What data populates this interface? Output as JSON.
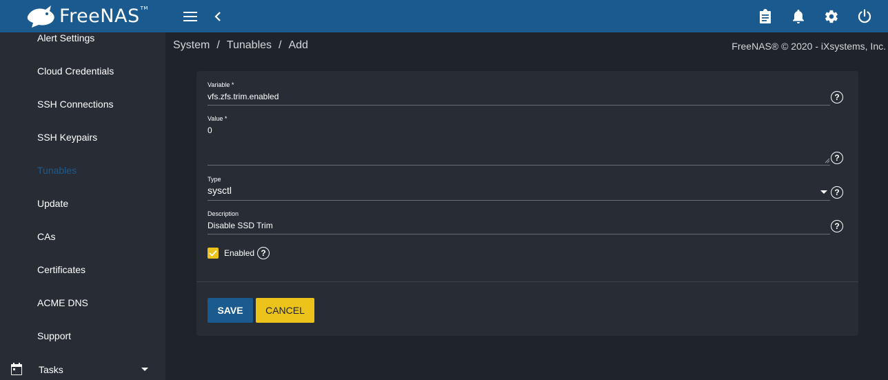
{
  "app": {
    "logo_text": "FreeNAS",
    "logo_tm": "TM"
  },
  "topbar": {
    "menu_icon": "hamburger-menu-icon",
    "back_icon": "chevron-left-icon",
    "right_icons": [
      "clipboard-icon",
      "bell-icon",
      "gear-icon",
      "power-icon"
    ]
  },
  "sidebar": {
    "items": [
      {
        "label": "Alert Settings"
      },
      {
        "label": "Cloud Credentials"
      },
      {
        "label": "SSH Connections"
      },
      {
        "label": "SSH Keypairs"
      },
      {
        "label": "Tunables",
        "active": true
      },
      {
        "label": "Update"
      },
      {
        "label": "CAs"
      },
      {
        "label": "Certificates"
      },
      {
        "label": "ACME DNS"
      },
      {
        "label": "Support"
      }
    ],
    "tasks": {
      "label": "Tasks",
      "icon": "calendar-icon"
    }
  },
  "breadcrumb": {
    "items": [
      "System",
      "Tunables",
      "Add"
    ],
    "separator": "/"
  },
  "copyright": "FreeNAS® © 2020 - iXsystems, Inc.",
  "form": {
    "variable": {
      "label": "Variable *",
      "value": "vfs.zfs.trim.enabled"
    },
    "value": {
      "label": "Value *",
      "value": "0"
    },
    "type": {
      "label": "Type",
      "value": "sysctl"
    },
    "description": {
      "label": "Description",
      "value": "Disable SSD Trim"
    },
    "enabled": {
      "label": "Enabled",
      "checked": true
    },
    "help_glyph": "?",
    "save_label": "SAVE",
    "cancel_label": "CANCEL"
  },
  "colors": {
    "topbar": "#1b5a8e",
    "sidebar": "#282d35",
    "background": "#1f232a",
    "card": "#282d35",
    "accent_yellow": "#ecc31a",
    "primary_blue": "#1b5a8e"
  }
}
